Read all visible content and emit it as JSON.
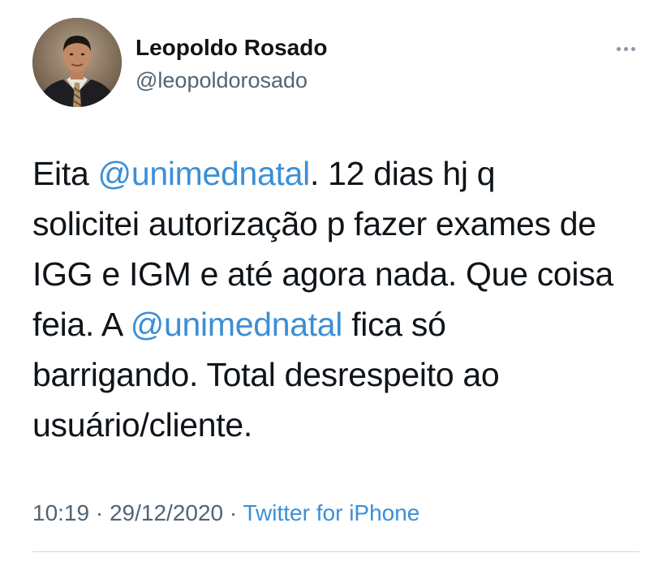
{
  "author": {
    "display_name": "Leopoldo Rosado",
    "handle": "@leopoldorosado"
  },
  "tweet": {
    "lines": [
      [
        {
          "t": "Eita "
        },
        {
          "t": "@unimednatal",
          "m": true
        },
        {
          "t": ". 12 dias hj q"
        }
      ],
      [
        {
          "t": "solicitei autorização p fazer exames de"
        }
      ],
      [
        {
          "t": "IGG e IGM e até agora nada. Que coisa"
        }
      ],
      [
        {
          "t": "feia. A "
        },
        {
          "t": "@unimednatal",
          "m": true
        },
        {
          "t": " fica só"
        }
      ],
      [
        {
          "t": "barrigando. Total desrespeito ao"
        }
      ],
      [
        {
          "t": "usuário/cliente."
        }
      ]
    ],
    "time": "10:19",
    "separator": " · ",
    "date": "29/12/2020",
    "source": "Twitter for iPhone"
  },
  "icons": {
    "more": "more-horizontal-icon"
  },
  "colors": {
    "text": "#0f1419",
    "secondary": "#536471",
    "link": "#3c8fd6",
    "divider": "#cfd9de"
  }
}
